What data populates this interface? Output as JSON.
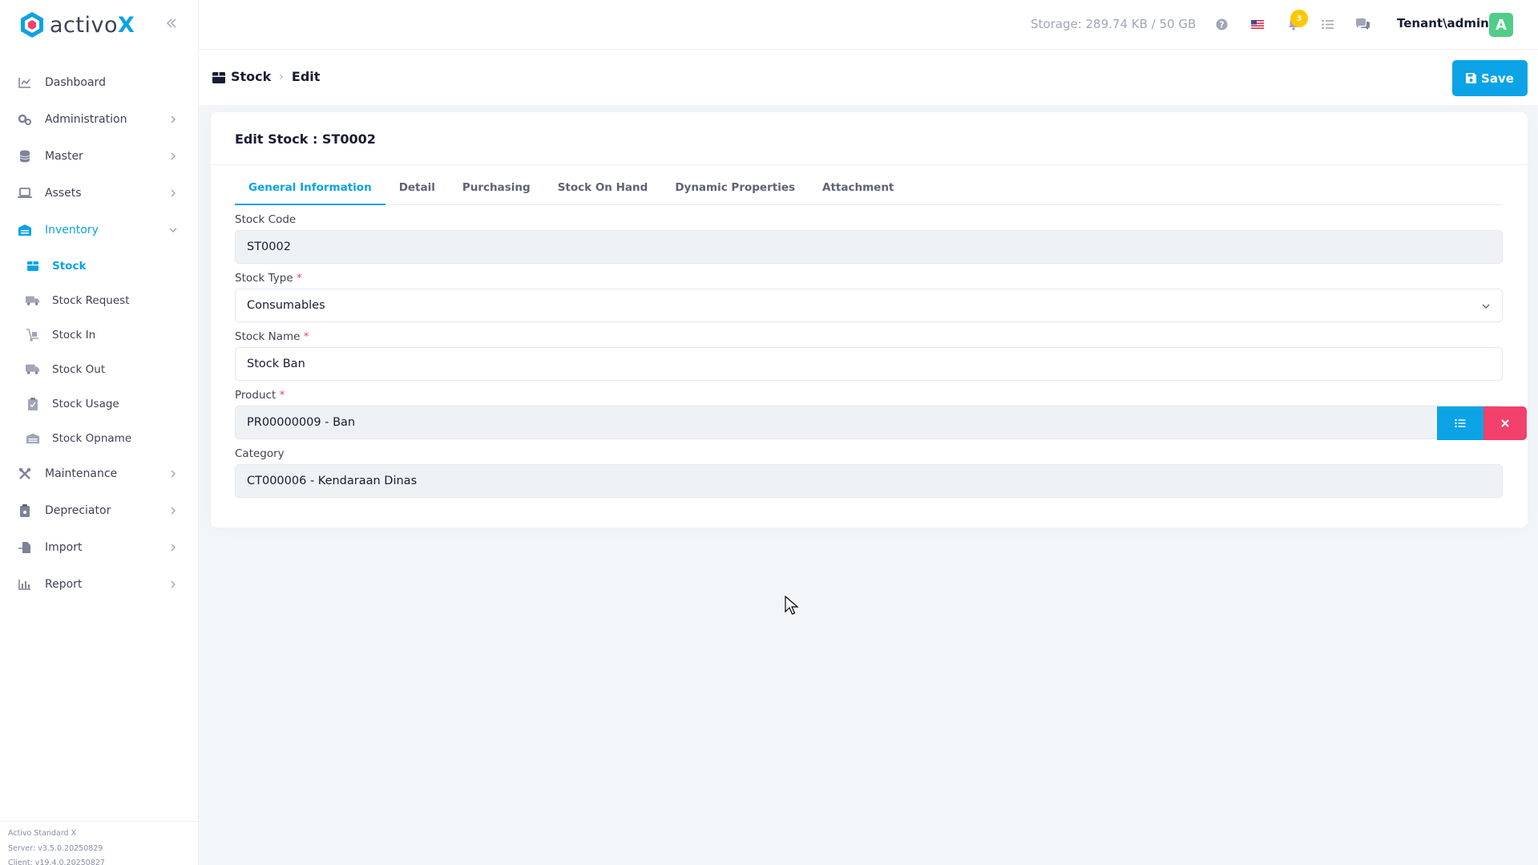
{
  "app": {
    "logo_text": "activo",
    "logo_accent": "X"
  },
  "sidebar": {
    "items": [
      {
        "label": "Dashboard",
        "icon": "chart-line-icon",
        "has_chevron": false
      },
      {
        "label": "Administration",
        "icon": "gears-icon",
        "has_chevron": true
      },
      {
        "label": "Master",
        "icon": "database-icon",
        "has_chevron": true
      },
      {
        "label": "Assets",
        "icon": "laptop-icon",
        "has_chevron": true
      },
      {
        "label": "Inventory",
        "icon": "warehouse-icon",
        "has_chevron": true,
        "expanded": true
      },
      {
        "label": "Maintenance",
        "icon": "tools-icon",
        "has_chevron": true
      },
      {
        "label": "Depreciator",
        "icon": "clipboard-icon",
        "has_chevron": true
      },
      {
        "label": "Import",
        "icon": "file-import-icon",
        "has_chevron": true
      },
      {
        "label": "Report",
        "icon": "bar-chart-icon",
        "has_chevron": true
      }
    ],
    "inventory_sub": [
      {
        "label": "Stock",
        "icon": "box-icon",
        "active": true
      },
      {
        "label": "Stock Request",
        "icon": "truck-icon"
      },
      {
        "label": "Stock In",
        "icon": "dolly-icon"
      },
      {
        "label": "Stock Out",
        "icon": "truck-moving-icon"
      },
      {
        "label": "Stock Usage",
        "icon": "clipboard-check-icon"
      },
      {
        "label": "Stock Opname",
        "icon": "warehouse-icon"
      }
    ],
    "footer": {
      "product": "Activo Standard X",
      "server": "Server: v3.5.0.20250829",
      "client": "Client: v19.4.0.20250827"
    }
  },
  "header": {
    "storage": "Storage: 289.74 KB / 50 GB",
    "notification_count": "3",
    "user": "Tenant\\admin",
    "avatar_letter": "A"
  },
  "breadcrumb": {
    "root": "Stock",
    "current": "Edit"
  },
  "toolbar": {
    "save_label": "Save"
  },
  "form": {
    "title": "Edit Stock : ST0002",
    "tabs": [
      "General Information",
      "Detail",
      "Purchasing",
      "Stock On Hand",
      "Dynamic Properties",
      "Attachment"
    ],
    "active_tab": "General Information",
    "fields": {
      "stock_code": {
        "label": "Stock Code",
        "value": "ST0002"
      },
      "stock_type": {
        "label": "Stock Type",
        "value": "Consumables",
        "required": "*"
      },
      "stock_name": {
        "label": "Stock Name",
        "value": "Stock Ban",
        "required": "*"
      },
      "product": {
        "label": "Product",
        "value": "PR00000009 - Ban",
        "required": "*"
      },
      "category": {
        "label": "Category",
        "value": "CT000006 - Kendaraan Dinas"
      }
    }
  },
  "colors": {
    "primary": "#0ba3e6",
    "danger": "#f1416c",
    "warning": "#ffc700",
    "success": "#50cd89"
  }
}
